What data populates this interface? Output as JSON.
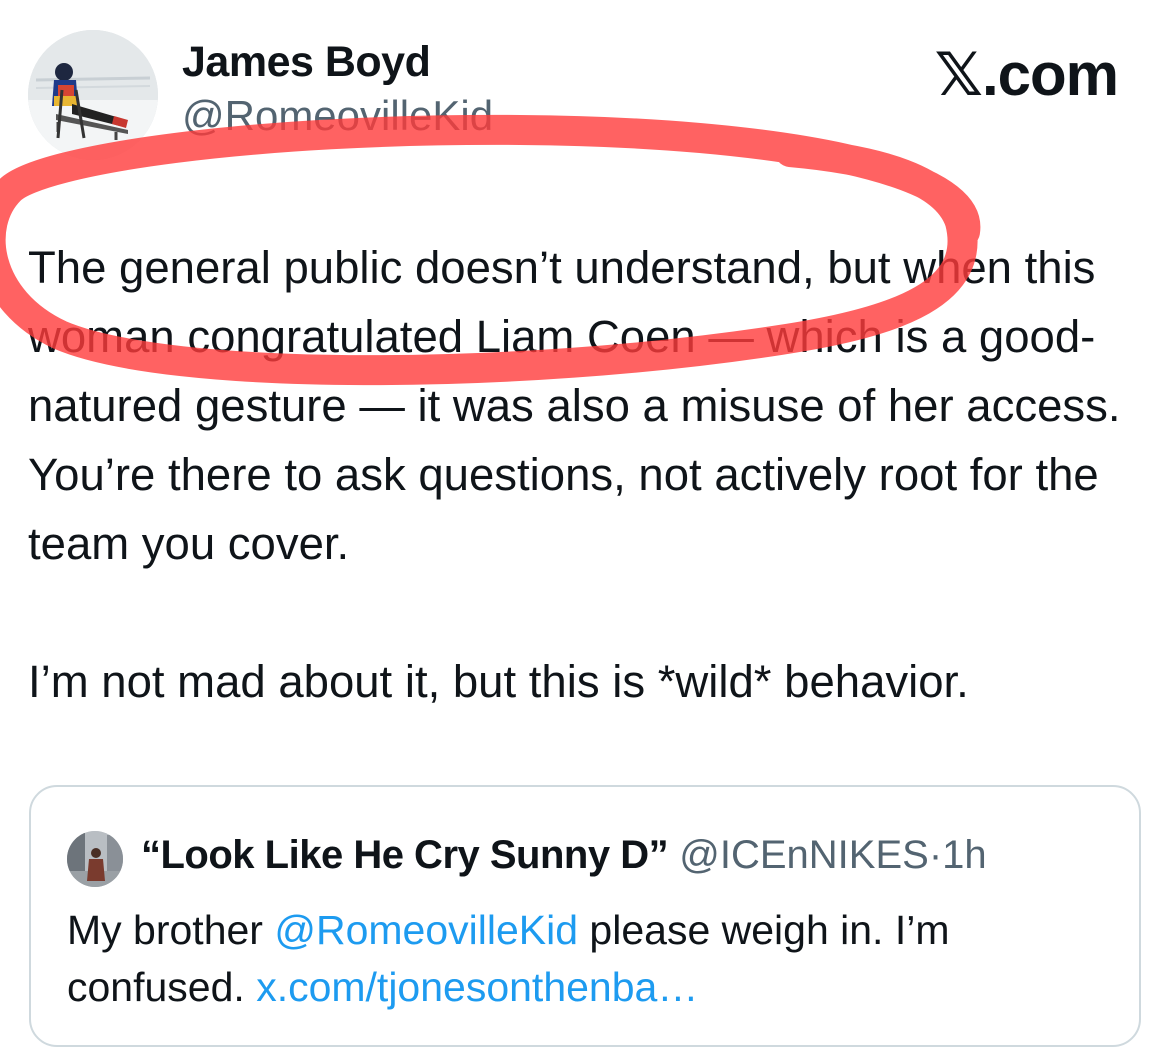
{
  "post": {
    "author": {
      "name": "James Boyd",
      "handle": "@RomeovilleKid",
      "avatar_icon": "profile-photo-sled-hockey"
    },
    "brand": "𝕏.com",
    "body": {
      "line1": "The general public doesn’t understand, but when this woman congratulated Liam Coen — which is a good-natured gesture — it was also a misuse of her access. You’re there to ask questions, not actively root for the team you cover.",
      "line2": "I’m not mad about it, but this is *wild* behavior."
    },
    "annotation": {
      "shape": "hand-drawn-ellipse",
      "color": "#ff3b3b"
    }
  },
  "quoted_post": {
    "author": {
      "name": "“Look Like He Cry Sunny D”",
      "handle": "@ICEnNIKES",
      "separator": "·",
      "time": "1h",
      "avatar_icon": "profile-photo-street"
    },
    "text_before": "My brother ",
    "mention": "@RomeovilleKid",
    "text_after": " please weigh in. I’m confused. ",
    "link": "x.com/tjonesonthenba…"
  },
  "colors": {
    "text": "#0f1419",
    "secondary": "#536471",
    "link": "#1d9bf0",
    "border": "#cfd9de"
  }
}
